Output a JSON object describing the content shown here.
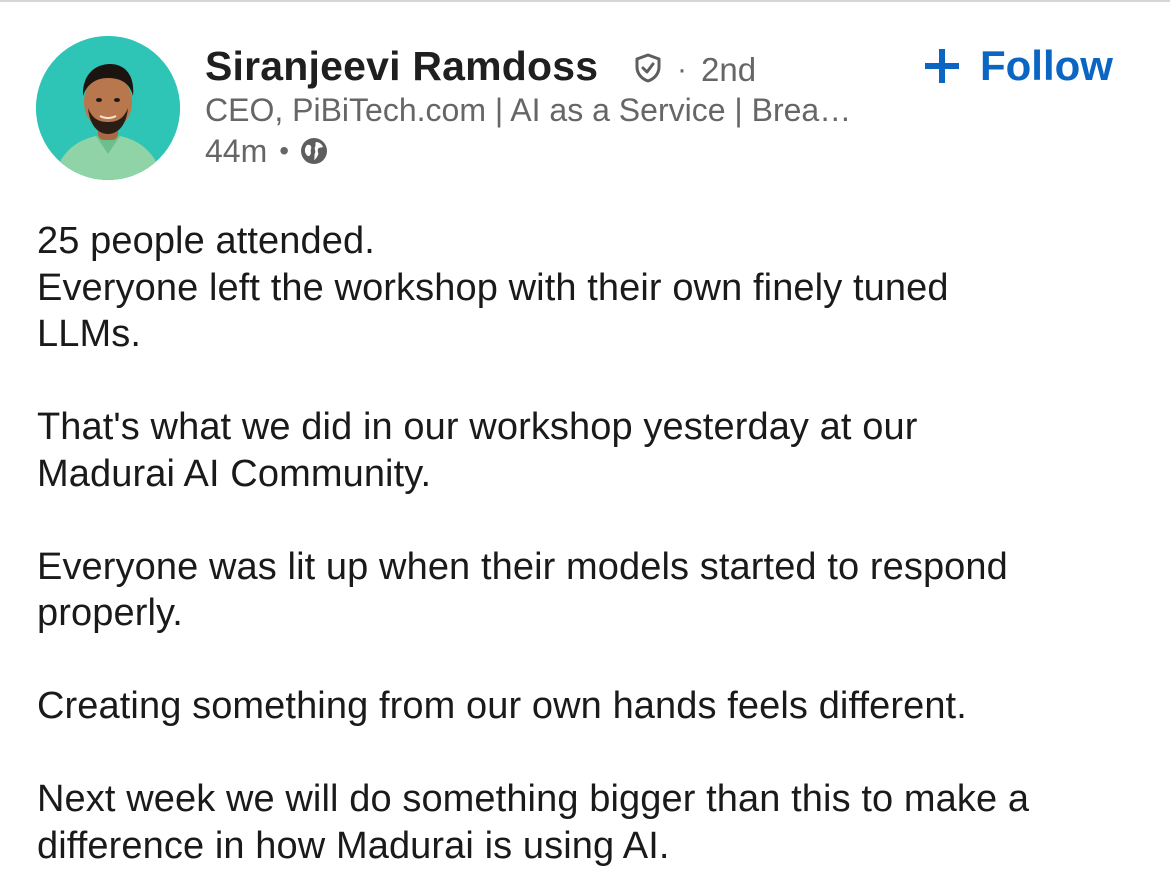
{
  "post": {
    "author": {
      "name": "Siranjeevi Ramdoss",
      "connection": "2nd",
      "headline": "CEO, PiBiTech.com | AI as a Service | Brea…",
      "time_ago": "44m",
      "visibility_icon": "globe-icon",
      "verified_icon": "shield-check-icon"
    },
    "follow_label": "Follow",
    "follow_icon": "plus-icon",
    "accent_color": "#0a66c2",
    "avatar_bg_color": "#2ec4b6",
    "body": {
      "p1": [
        "25 people attended.",
        "Everyone left the workshop with their own finely tuned",
        "LLMs."
      ],
      "p2": [
        "That's what we did in our workshop yesterday at our",
        "Madurai AI Community."
      ],
      "p3": [
        "Everyone was lit up when their models started to respond",
        "properly."
      ],
      "p4": [
        "Creating something from our own hands feels different."
      ],
      "p5": [
        "Next week we will do something bigger than this to make a",
        "difference in how Madurai is using AI."
      ]
    }
  }
}
